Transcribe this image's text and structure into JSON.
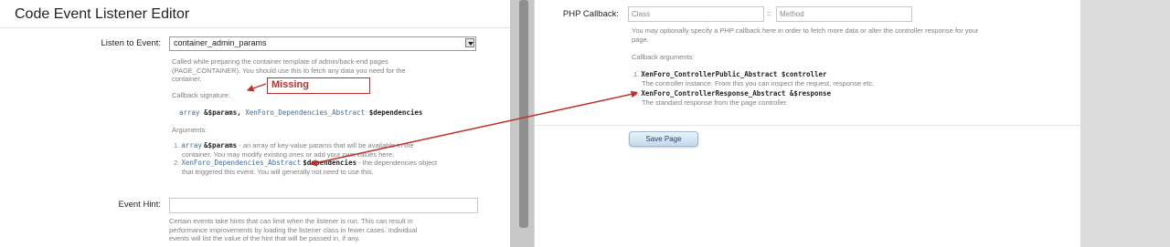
{
  "page": {
    "title": "Code Event Listener Editor"
  },
  "listen": {
    "label": "Listen to Event:",
    "value": "container_admin_params",
    "hint_lines": [
      "Called while preparing the container template of admin/back-end pages",
      "(PAGE_CONTAINER). You should use this to fetch any data you need for the",
      "container."
    ],
    "callback_signature_label": "Callback signature:",
    "signature": {
      "t1": "array",
      "p1": "&$params,",
      "t2": "XenForo_Dependencies_Abstract",
      "p2": "$dependencies"
    },
    "arguments_label": "Arguments:",
    "args": [
      {
        "num": "1.",
        "type": "array",
        "param": "&$params",
        "desc_lines": [
          " - an array of key-value params that will be available in the",
          "container. You may modify existing ones or add your own values here."
        ]
      },
      {
        "num": "2.",
        "type": "XenForo_Dependencies_Abstract",
        "param": "$dependencies",
        "desc_lines": [
          " - the dependencies object",
          "that triggered this event. You will generally not need to use this."
        ]
      }
    ]
  },
  "annotation": {
    "missing": "Missing"
  },
  "event_hint": {
    "label": "Event Hint:",
    "value": "",
    "hint_lines": [
      "Certain events take hints that can limit when the listener is run. This can result in",
      "performance improvements by loading the listener class in fewer cases. Individual",
      "events will list the value of the hint that will be passed in, if any."
    ]
  },
  "php_callback": {
    "label": "PHP Callback:",
    "class_placeholder": "Class",
    "separator": "::",
    "method_placeholder": "Method",
    "hint_lines": [
      "You may optionally specify a PHP callback here in order to fetch more data or alter the controller response for your",
      "page."
    ],
    "callback_args_label": "Callback arguments:",
    "args": [
      {
        "num": "1.",
        "sig": "XenForo_ControllerPublic_Abstract $controller",
        "desc": "The controller instance. From this you can inspect the request, response etc."
      },
      {
        "num": "2.",
        "sig": "XenForo_ControllerResponse_Abstract &$response",
        "desc": "The standard response from the page controller."
      }
    ]
  },
  "save_button": "Save Page",
  "colors": {
    "accent_link": "#3a6ea5",
    "annotation_red": "#c0302a"
  }
}
